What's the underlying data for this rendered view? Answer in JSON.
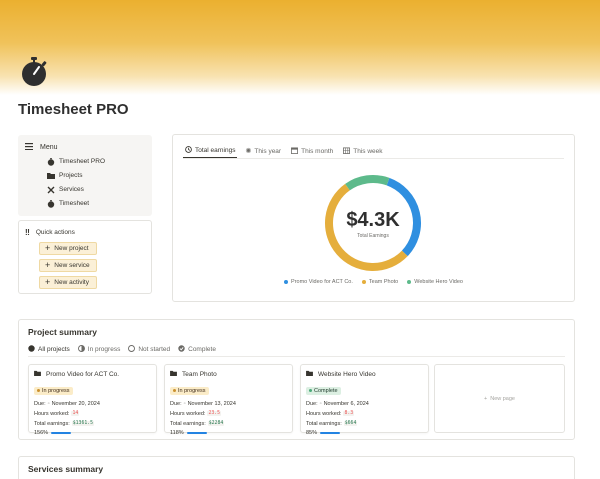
{
  "colors": {
    "accent_yellow": "#ebb02f",
    "blue": "#2f8fe0",
    "yellow": "#e5ae3c",
    "green": "#5dba8b"
  },
  "page": {
    "title": "Timesheet PRO",
    "icon": "stopwatch-icon"
  },
  "menu": {
    "title": "Menu",
    "items": [
      {
        "label": "Timesheet PRO",
        "icon": "stopwatch-icon"
      },
      {
        "label": "Projects",
        "icon": "folder-icon"
      },
      {
        "label": "Services",
        "icon": "tools-icon"
      },
      {
        "label": "Timesheet",
        "icon": "stopwatch-icon"
      }
    ]
  },
  "quick_actions": {
    "title": "Quick actions",
    "buttons": [
      {
        "label": "New project"
      },
      {
        "label": "New service"
      },
      {
        "label": "New activity"
      }
    ]
  },
  "earnings": {
    "tabs": [
      "Total earnings",
      "This year",
      "This month",
      "This week"
    ],
    "active_tab": "Total earnings",
    "total": "$4.3K",
    "total_label": "Total Earnings",
    "chart_data": {
      "type": "pie",
      "categories": [
        "Promo Video for ACT Co.",
        "Team Photo",
        "Website Hero Video"
      ],
      "values": [
        1361.5,
        2284,
        664
      ],
      "colors": [
        "#2f8fe0",
        "#e5ae3c",
        "#5dba8b"
      ],
      "title": "$4.3K"
    }
  },
  "project_summary": {
    "title": "Project summary",
    "tabs": [
      "All projects",
      "In progress",
      "Not started",
      "Complete"
    ],
    "active_tab": "All projects",
    "cards": [
      {
        "title": "Promo Video for ACT Co.",
        "status": "In progress",
        "due_label": "Due:",
        "due": "November 20, 2024",
        "hours_label": "Hours worked:",
        "hours": "14",
        "earn_label": "Total earnings:",
        "earnings": "$1361.5",
        "progress": "156%"
      },
      {
        "title": "Team Photo",
        "status": "In progress",
        "due_label": "Due:",
        "due": "November 13, 2024",
        "hours_label": "Hours worked:",
        "hours": "23.5",
        "earn_label": "Total earnings:",
        "earnings": "$2284",
        "progress": "118%"
      },
      {
        "title": "Website Hero Video",
        "status": "Complete",
        "due_label": "Due:",
        "due": "November 6, 2024",
        "hours_label": "Hours worked:",
        "hours": "8.3",
        "earn_label": "Total earnings:",
        "earnings": "$664",
        "progress": "85%"
      }
    ],
    "new_label": "New page"
  },
  "services_summary": {
    "title": "Services summary"
  }
}
